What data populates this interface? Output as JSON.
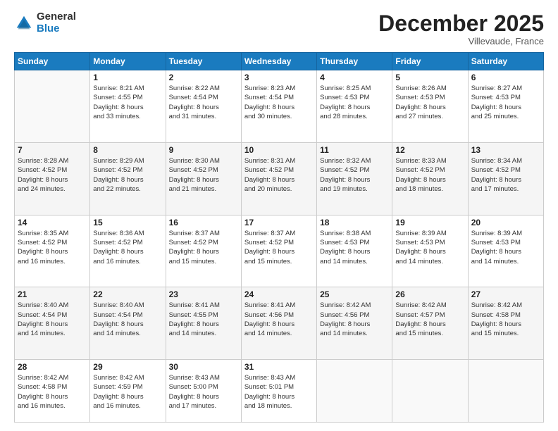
{
  "logo": {
    "general": "General",
    "blue": "Blue"
  },
  "header": {
    "month": "December 2025",
    "location": "Villevaude, France"
  },
  "days_of_week": [
    "Sunday",
    "Monday",
    "Tuesday",
    "Wednesday",
    "Thursday",
    "Friday",
    "Saturday"
  ],
  "weeks": [
    [
      {
        "day": "",
        "info": ""
      },
      {
        "day": "1",
        "info": "Sunrise: 8:21 AM\nSunset: 4:55 PM\nDaylight: 8 hours\nand 33 minutes."
      },
      {
        "day": "2",
        "info": "Sunrise: 8:22 AM\nSunset: 4:54 PM\nDaylight: 8 hours\nand 31 minutes."
      },
      {
        "day": "3",
        "info": "Sunrise: 8:23 AM\nSunset: 4:54 PM\nDaylight: 8 hours\nand 30 minutes."
      },
      {
        "day": "4",
        "info": "Sunrise: 8:25 AM\nSunset: 4:53 PM\nDaylight: 8 hours\nand 28 minutes."
      },
      {
        "day": "5",
        "info": "Sunrise: 8:26 AM\nSunset: 4:53 PM\nDaylight: 8 hours\nand 27 minutes."
      },
      {
        "day": "6",
        "info": "Sunrise: 8:27 AM\nSunset: 4:53 PM\nDaylight: 8 hours\nand 25 minutes."
      }
    ],
    [
      {
        "day": "7",
        "info": "Sunrise: 8:28 AM\nSunset: 4:52 PM\nDaylight: 8 hours\nand 24 minutes."
      },
      {
        "day": "8",
        "info": "Sunrise: 8:29 AM\nSunset: 4:52 PM\nDaylight: 8 hours\nand 22 minutes."
      },
      {
        "day": "9",
        "info": "Sunrise: 8:30 AM\nSunset: 4:52 PM\nDaylight: 8 hours\nand 21 minutes."
      },
      {
        "day": "10",
        "info": "Sunrise: 8:31 AM\nSunset: 4:52 PM\nDaylight: 8 hours\nand 20 minutes."
      },
      {
        "day": "11",
        "info": "Sunrise: 8:32 AM\nSunset: 4:52 PM\nDaylight: 8 hours\nand 19 minutes."
      },
      {
        "day": "12",
        "info": "Sunrise: 8:33 AM\nSunset: 4:52 PM\nDaylight: 8 hours\nand 18 minutes."
      },
      {
        "day": "13",
        "info": "Sunrise: 8:34 AM\nSunset: 4:52 PM\nDaylight: 8 hours\nand 17 minutes."
      }
    ],
    [
      {
        "day": "14",
        "info": "Sunrise: 8:35 AM\nSunset: 4:52 PM\nDaylight: 8 hours\nand 16 minutes."
      },
      {
        "day": "15",
        "info": "Sunrise: 8:36 AM\nSunset: 4:52 PM\nDaylight: 8 hours\nand 16 minutes."
      },
      {
        "day": "16",
        "info": "Sunrise: 8:37 AM\nSunset: 4:52 PM\nDaylight: 8 hours\nand 15 minutes."
      },
      {
        "day": "17",
        "info": "Sunrise: 8:37 AM\nSunset: 4:52 PM\nDaylight: 8 hours\nand 15 minutes."
      },
      {
        "day": "18",
        "info": "Sunrise: 8:38 AM\nSunset: 4:53 PM\nDaylight: 8 hours\nand 14 minutes."
      },
      {
        "day": "19",
        "info": "Sunrise: 8:39 AM\nSunset: 4:53 PM\nDaylight: 8 hours\nand 14 minutes."
      },
      {
        "day": "20",
        "info": "Sunrise: 8:39 AM\nSunset: 4:53 PM\nDaylight: 8 hours\nand 14 minutes."
      }
    ],
    [
      {
        "day": "21",
        "info": "Sunrise: 8:40 AM\nSunset: 4:54 PM\nDaylight: 8 hours\nand 14 minutes."
      },
      {
        "day": "22",
        "info": "Sunrise: 8:40 AM\nSunset: 4:54 PM\nDaylight: 8 hours\nand 14 minutes."
      },
      {
        "day": "23",
        "info": "Sunrise: 8:41 AM\nSunset: 4:55 PM\nDaylight: 8 hours\nand 14 minutes."
      },
      {
        "day": "24",
        "info": "Sunrise: 8:41 AM\nSunset: 4:56 PM\nDaylight: 8 hours\nand 14 minutes."
      },
      {
        "day": "25",
        "info": "Sunrise: 8:42 AM\nSunset: 4:56 PM\nDaylight: 8 hours\nand 14 minutes."
      },
      {
        "day": "26",
        "info": "Sunrise: 8:42 AM\nSunset: 4:57 PM\nDaylight: 8 hours\nand 15 minutes."
      },
      {
        "day": "27",
        "info": "Sunrise: 8:42 AM\nSunset: 4:58 PM\nDaylight: 8 hours\nand 15 minutes."
      }
    ],
    [
      {
        "day": "28",
        "info": "Sunrise: 8:42 AM\nSunset: 4:58 PM\nDaylight: 8 hours\nand 16 minutes."
      },
      {
        "day": "29",
        "info": "Sunrise: 8:42 AM\nSunset: 4:59 PM\nDaylight: 8 hours\nand 16 minutes."
      },
      {
        "day": "30",
        "info": "Sunrise: 8:43 AM\nSunset: 5:00 PM\nDaylight: 8 hours\nand 17 minutes."
      },
      {
        "day": "31",
        "info": "Sunrise: 8:43 AM\nSunset: 5:01 PM\nDaylight: 8 hours\nand 18 minutes."
      },
      {
        "day": "",
        "info": ""
      },
      {
        "day": "",
        "info": ""
      },
      {
        "day": "",
        "info": ""
      }
    ]
  ]
}
